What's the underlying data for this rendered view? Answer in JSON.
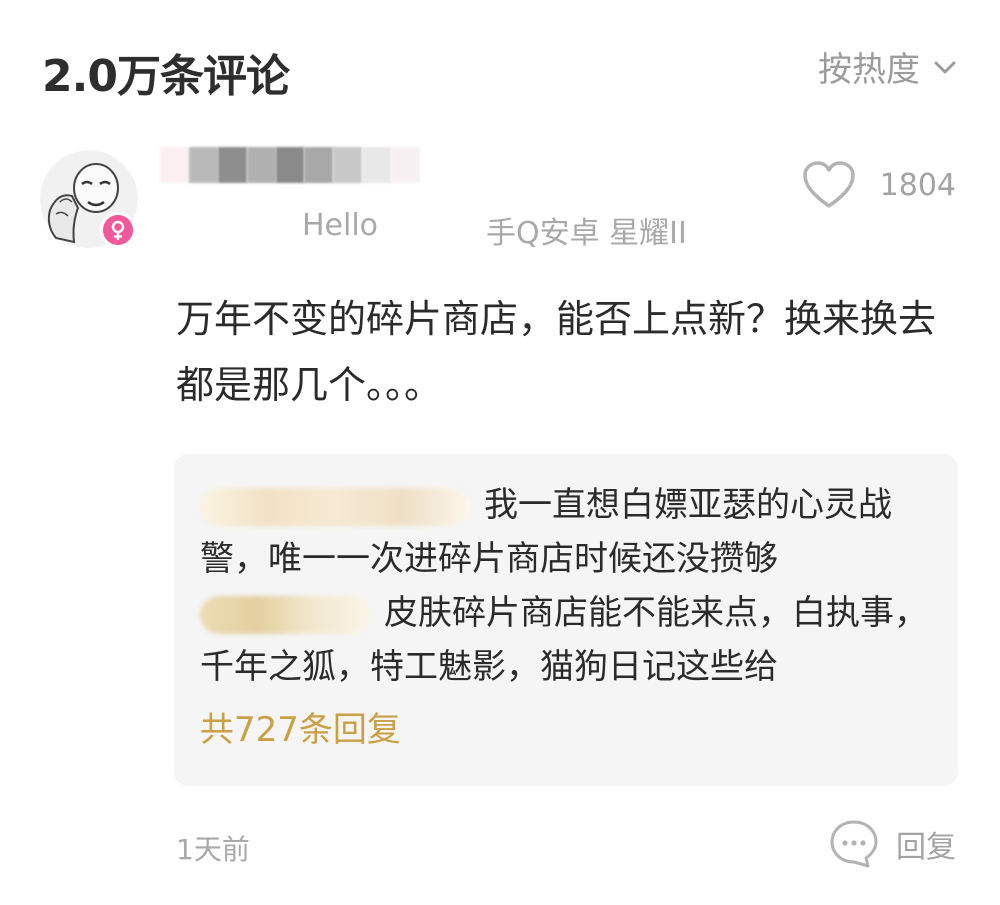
{
  "header": {
    "title": "2.0万条评论",
    "sort_label": "按热度"
  },
  "comment": {
    "meta_left": "Hello",
    "meta_right": "手Q安卓 星耀II",
    "like_count": "1804",
    "text": "万年不变的碎片商店，能否上点新？换来换去都是那几个。。。",
    "time": "1天前",
    "reply_label": "回复"
  },
  "replies": {
    "reply1_text": "我一直想白嫖亚瑟的心灵战警，唯一一次进碎片商店时候还没攒够",
    "reply2_text": "皮肤碎片商店能不能来点，白执事，千年之狐，特工魅影，猫狗日记这些给",
    "more_label": "共727条回复"
  },
  "colors": {
    "accent_gold": "#c9a043",
    "female_badge": "#f2589a",
    "muted_text": "#a9a9a9"
  }
}
